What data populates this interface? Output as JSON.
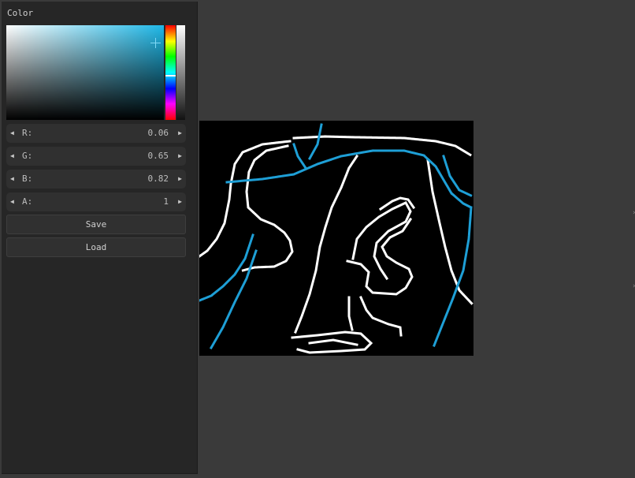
{
  "panel": {
    "title": "Color"
  },
  "color": {
    "accent": "#1eb8e8",
    "stroke_blue": "#1e9fd6",
    "stroke_white": "#ffffff"
  },
  "sliders": [
    {
      "label": "R:",
      "value": "0.06"
    },
    {
      "label": "G:",
      "value": "0.65"
    },
    {
      "label": "B:",
      "value": "0.82"
    },
    {
      "label": "A:",
      "value": "1"
    }
  ],
  "buttons": {
    "save": "Save",
    "load": "Load"
  },
  "icons": {
    "arrow_left": "◀",
    "arrow_right": "▶"
  }
}
